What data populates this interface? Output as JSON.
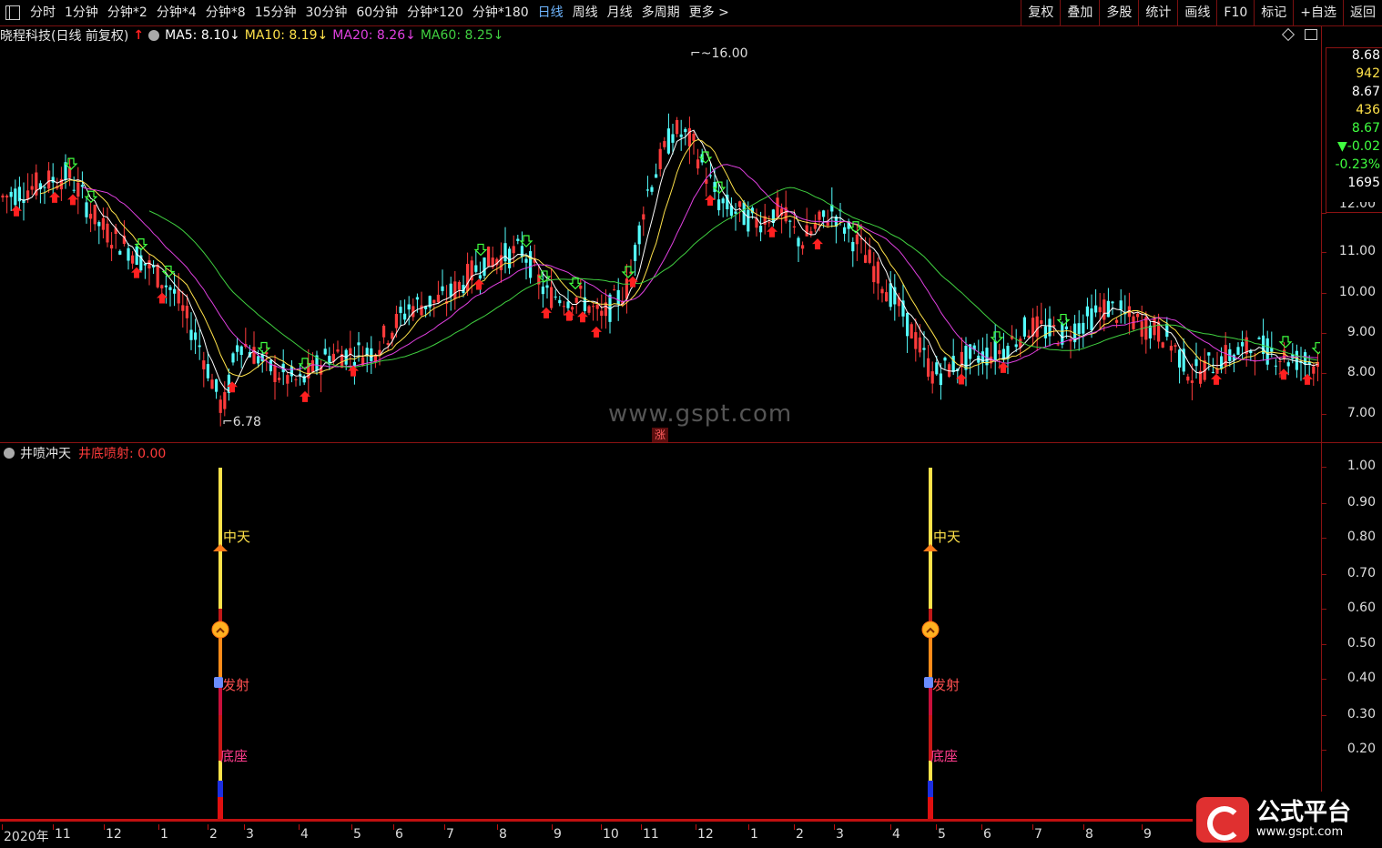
{
  "toolbar": {
    "periods": [
      "分时",
      "1分钟",
      "分钟*2",
      "分钟*4",
      "分钟*8",
      "15分钟",
      "30分钟",
      "60分钟",
      "分钟*120",
      "分钟*180",
      "日线",
      "周线",
      "月线",
      "多周期",
      "更多 >"
    ],
    "active_period": "日线",
    "right_buttons": [
      "复权",
      "叠加",
      "多股",
      "统计",
      "画线",
      "F10",
      "标记",
      "+自选",
      "返回"
    ]
  },
  "info": {
    "stock_name": "晓程科技(日线 前复权)",
    "ma5": "MA5: 8.10↓",
    "ma10": "MA10: 8.19↓",
    "ma20": "MA20: 8.26↓",
    "ma60": "MA60: 8.25↓"
  },
  "price_box": [
    "8.68",
    "942",
    "8.67",
    "436",
    "8.67",
    "▼-0.02",
    "-0.23%",
    "1695"
  ],
  "price_box_colors": [
    "#ffffff",
    "#ffe24a",
    "#ffffff",
    "#ffe24a",
    "#40ff40",
    "#40ff40",
    "#40ff40",
    "#ffffff"
  ],
  "price_ticks": [
    "12.00",
    "11.00",
    "10.00",
    "9.00",
    "8.00",
    "7.00"
  ],
  "sub_ticks": [
    "1.00",
    "0.90",
    "0.80",
    "0.70",
    "0.60",
    "0.50",
    "0.40",
    "0.30",
    "0.20"
  ],
  "annotations": {
    "high": "16.00",
    "low": "6.78",
    "zhang": "涨"
  },
  "watermark": "www.gspt.com",
  "indicator": {
    "name": "井喷冲天",
    "value_label": "井底喷射: 0.00"
  },
  "signal_labels": {
    "top": "中天",
    "mid": "发射",
    "bottom": "底座"
  },
  "dates": [
    "2020年",
    "11",
    "12",
    "1",
    "2",
    "3",
    "4",
    "5",
    "6",
    "7",
    "8",
    "9",
    "10",
    "11",
    "12",
    "1",
    "2",
    "3",
    "4",
    "5",
    "6",
    "7",
    "8",
    "9"
  ],
  "logo": {
    "title": "公式平台",
    "url": "www.gspt.com"
  },
  "colors": {
    "up": "#ff3b3b",
    "down": "#54ffff",
    "ma5": "#ffffff",
    "ma10": "#ffe24a",
    "ma20": "#e040e0",
    "ma60": "#40d040",
    "accent": "#6fb6ff"
  }
}
